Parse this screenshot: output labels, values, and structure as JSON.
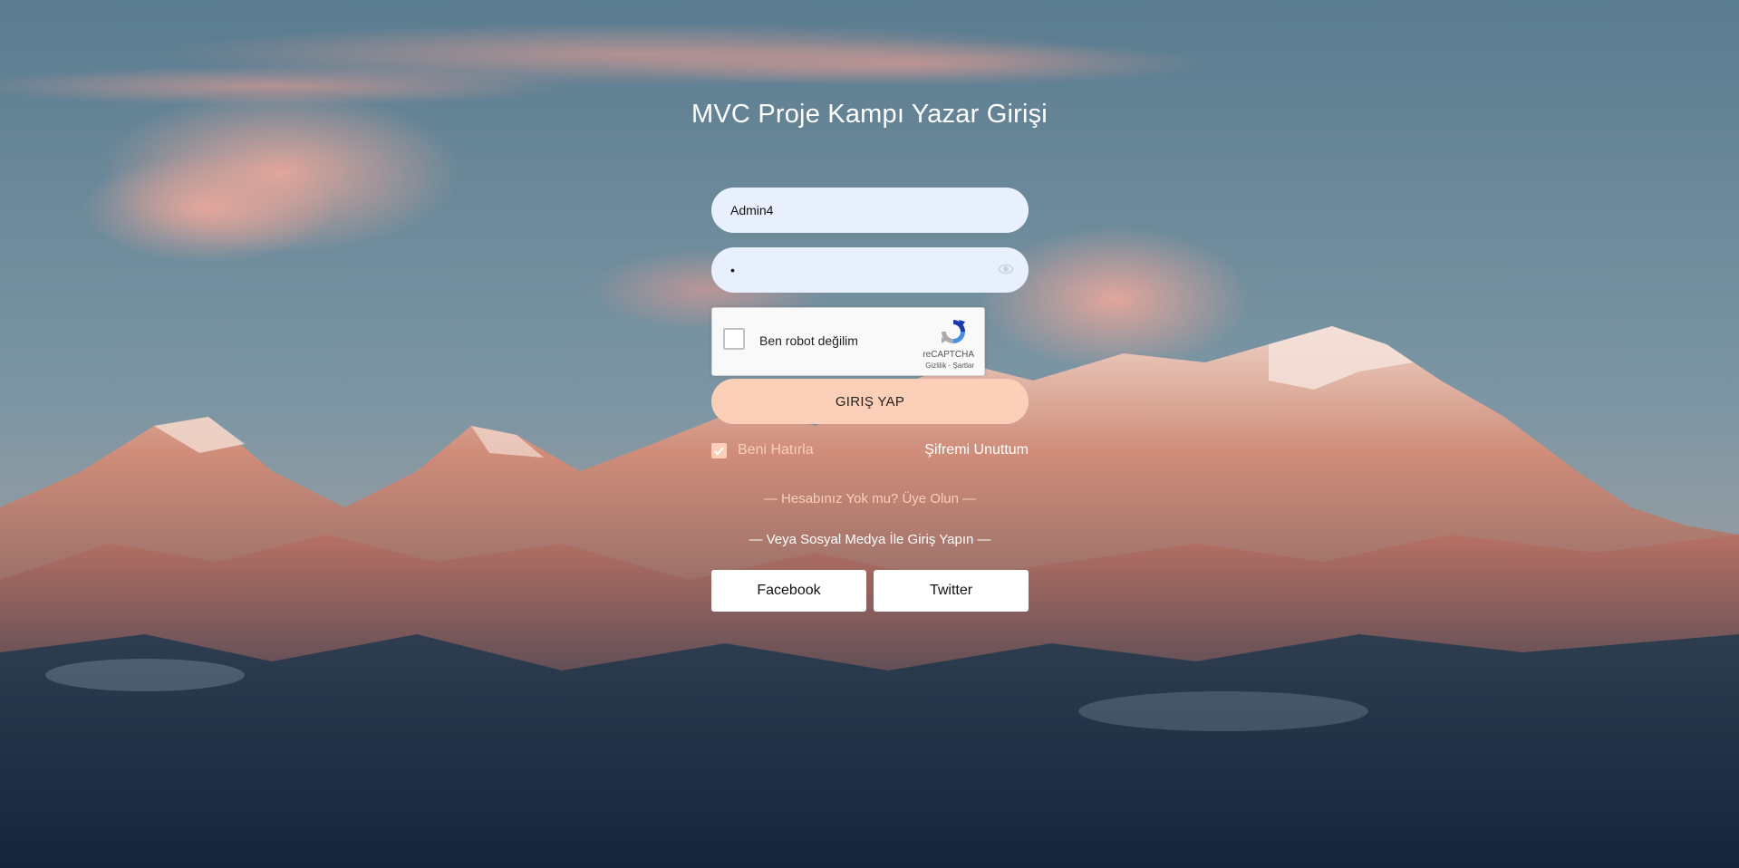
{
  "page": {
    "title": "MVC Proje Kampı Yazar Girişi"
  },
  "form": {
    "username_value": "Admin4",
    "password_value": "•",
    "recaptcha": {
      "label": "Ben robot değilim",
      "brand": "reCAPTCHA",
      "terms": "Gizlilik - Şartlar"
    },
    "login_label": "GIRIŞ YAP",
    "remember_label": "Beni Hatırla",
    "forgot_label": "Şifremi Unuttum",
    "signup_text": "— Hesabınız Yok mu? Üye Olun —",
    "social_title": "— Veya Sosyal Medya İle Giriş Yapın —",
    "facebook_label": "Facebook",
    "twitter_label": "Twitter"
  },
  "colors": {
    "accent": "#fbcfb8",
    "input_bg": "#e8f0fe"
  },
  "icons": {
    "password_toggle": "eye-icon",
    "remember_checkbox": "checkmark-icon",
    "recaptcha_logo": "recaptcha-logo-icon"
  }
}
